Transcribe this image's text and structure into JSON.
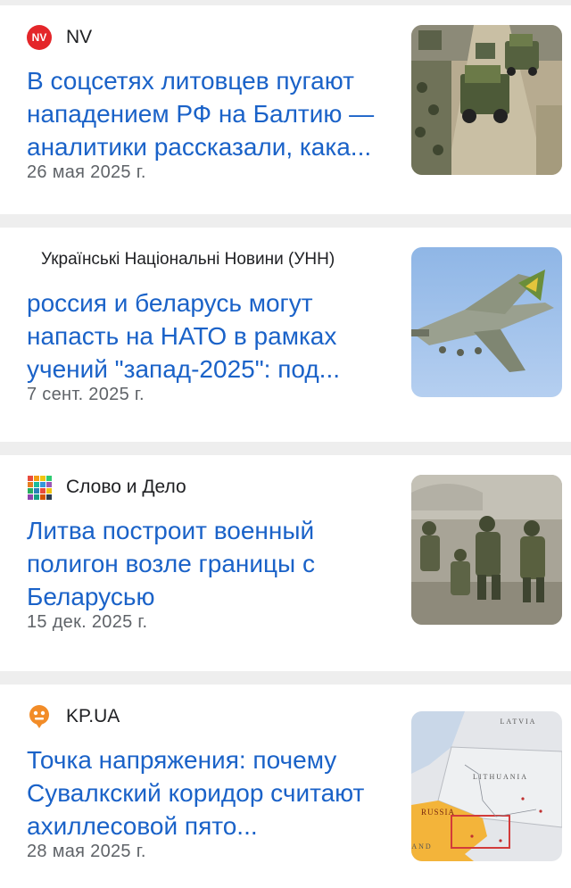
{
  "articles": [
    {
      "source": "NV",
      "logo_icon": "nv-logo-icon",
      "headline": "В соцсетях литовцев пугают нападением РФ на Балтию — аналитики рассказали, кака...",
      "date": "26 мая 2025 г.",
      "thumbnail": "military-trucks-image"
    },
    {
      "source": "Українські Національні Новини (УНН)",
      "logo_icon": "none",
      "headline": "россия и беларусь могут напасть на НАТО в рамках учений \"запад-2025\": под...",
      "date": "7 сент. 2025 г.",
      "thumbnail": "fighter-jet-image"
    },
    {
      "source": "Слово и Дело",
      "logo_icon": "colored-dots-grid-icon",
      "headline": "Литва построит военный полигон возле границы с Беларусью",
      "date": "15 дек. 2025 г.",
      "thumbnail": "soldiers-image"
    },
    {
      "source": "KP.UA",
      "logo_icon": "kp-ua-logo-icon",
      "headline": "Точка напряжения: почему Сувалкский коридор считают ахиллесовой пято...",
      "date": "28 мая 2025 г.",
      "thumbnail": "suwalki-map-image"
    }
  ],
  "map_labels": {
    "latvia": "LATVIA",
    "lithuania": "LITHUANIA",
    "russia": "RUSSIA",
    "poland_fragment": "AND"
  },
  "colors": {
    "headline": "#1a62c8",
    "nv_brand": "#e4262a",
    "kp_brand": "#f28c28"
  }
}
